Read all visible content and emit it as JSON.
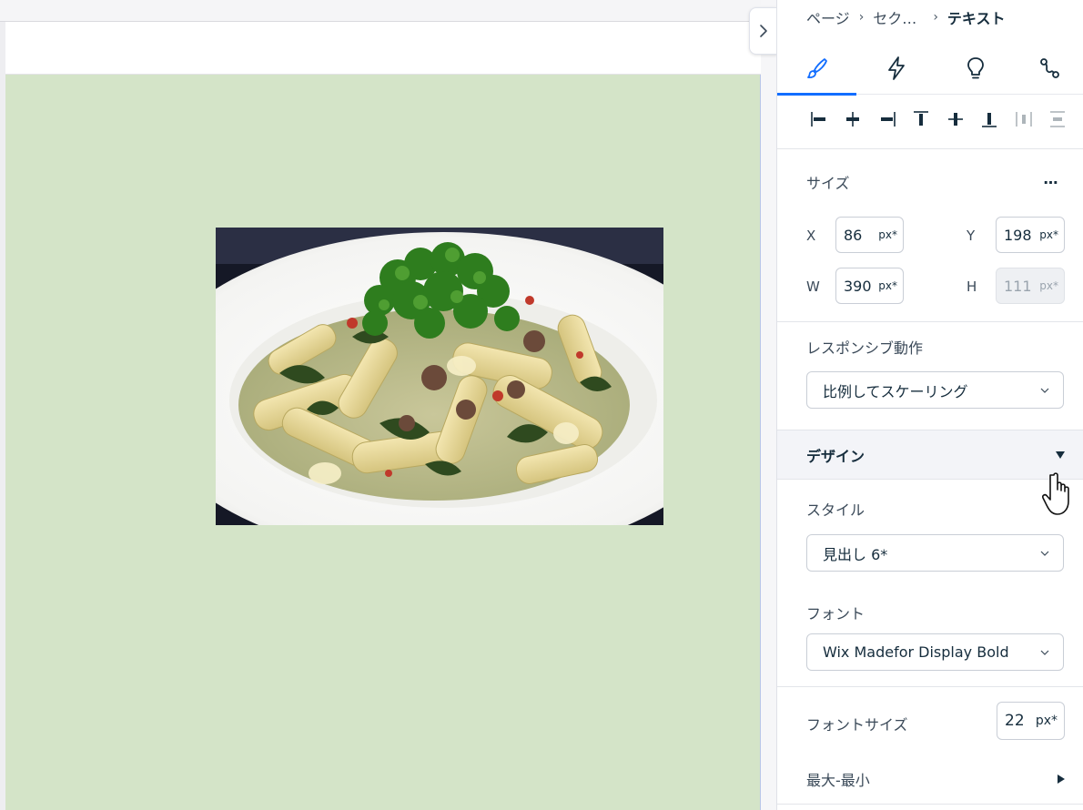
{
  "breadcrumb": {
    "items": [
      "ページ",
      "セク…",
      "テキスト"
    ],
    "separator": "›"
  },
  "tabs": [
    {
      "name": "design",
      "icon": "paintbrush-icon",
      "active": true
    },
    {
      "name": "interactions",
      "icon": "lightning-icon",
      "active": false
    },
    {
      "name": "tips",
      "icon": "lightbulb-icon",
      "active": false
    },
    {
      "name": "connect",
      "icon": "connector-icon",
      "active": false
    }
  ],
  "align_tools": [
    "align-left-icon",
    "align-center-horizontal-icon",
    "align-right-icon",
    "align-top-icon",
    "align-center-vertical-icon",
    "align-bottom-icon",
    "distribute-horizontal-icon",
    "distribute-vertical-icon"
  ],
  "size": {
    "label": "サイズ",
    "more_label": "…",
    "x": {
      "label": "X",
      "value": "86",
      "unit": "px*"
    },
    "y": {
      "label": "Y",
      "value": "198",
      "unit": "px*"
    },
    "w": {
      "label": "W",
      "value": "390",
      "unit": "px*"
    },
    "h": {
      "label": "H",
      "value": "111",
      "unit": "px*",
      "disabled": true
    }
  },
  "responsive": {
    "label": "レスポンシブ動作",
    "value": "比例してスケーリング"
  },
  "design": {
    "title": "デザイン",
    "style_label": "スタイル",
    "style_value": "見出し 6*",
    "font_label": "フォント",
    "font_value": "Wix Madefor Display Bold",
    "font_size_label": "フォントサイズ",
    "font_size_value": "22",
    "font_size_unit": "px*",
    "minmax_label": "最大-最小"
  },
  "colors": {
    "accent": "#116dff",
    "section_background": "#d4e4c8"
  }
}
